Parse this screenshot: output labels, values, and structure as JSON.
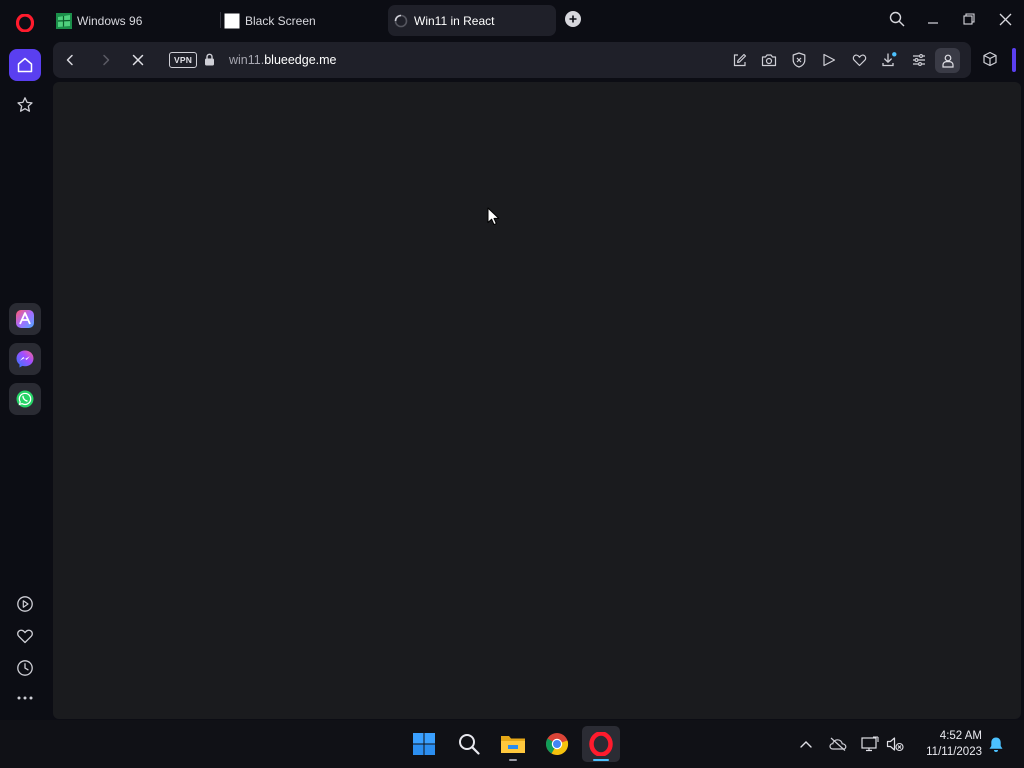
{
  "browser": {
    "tabs": [
      {
        "title": "Windows 96",
        "favicon": "windows96-favicon",
        "active": false
      },
      {
        "title": "Black Screen",
        "favicon": "white-square-favicon",
        "active": false
      },
      {
        "title": "Win11 in React",
        "favicon": "loading-spinner-icon",
        "active": true
      }
    ],
    "address": {
      "vpn_label": "VPN",
      "subdomain": "win11.",
      "domain": "blueedge.me"
    },
    "accent_color": "#5a3ff0"
  },
  "sidebar": {
    "items": [
      "home-icon",
      "bookmarks-icon",
      "aria-icon",
      "messenger-icon",
      "whatsapp-icon",
      "player-icon",
      "my-flow-icon",
      "history-icon",
      "more-icon"
    ]
  },
  "taskbar": {
    "apps": [
      "start-icon",
      "search-icon",
      "file-explorer-icon",
      "chrome-icon",
      "opera-icon"
    ],
    "clock": {
      "time": "4:52 AM",
      "date": "11/11/2023"
    }
  }
}
